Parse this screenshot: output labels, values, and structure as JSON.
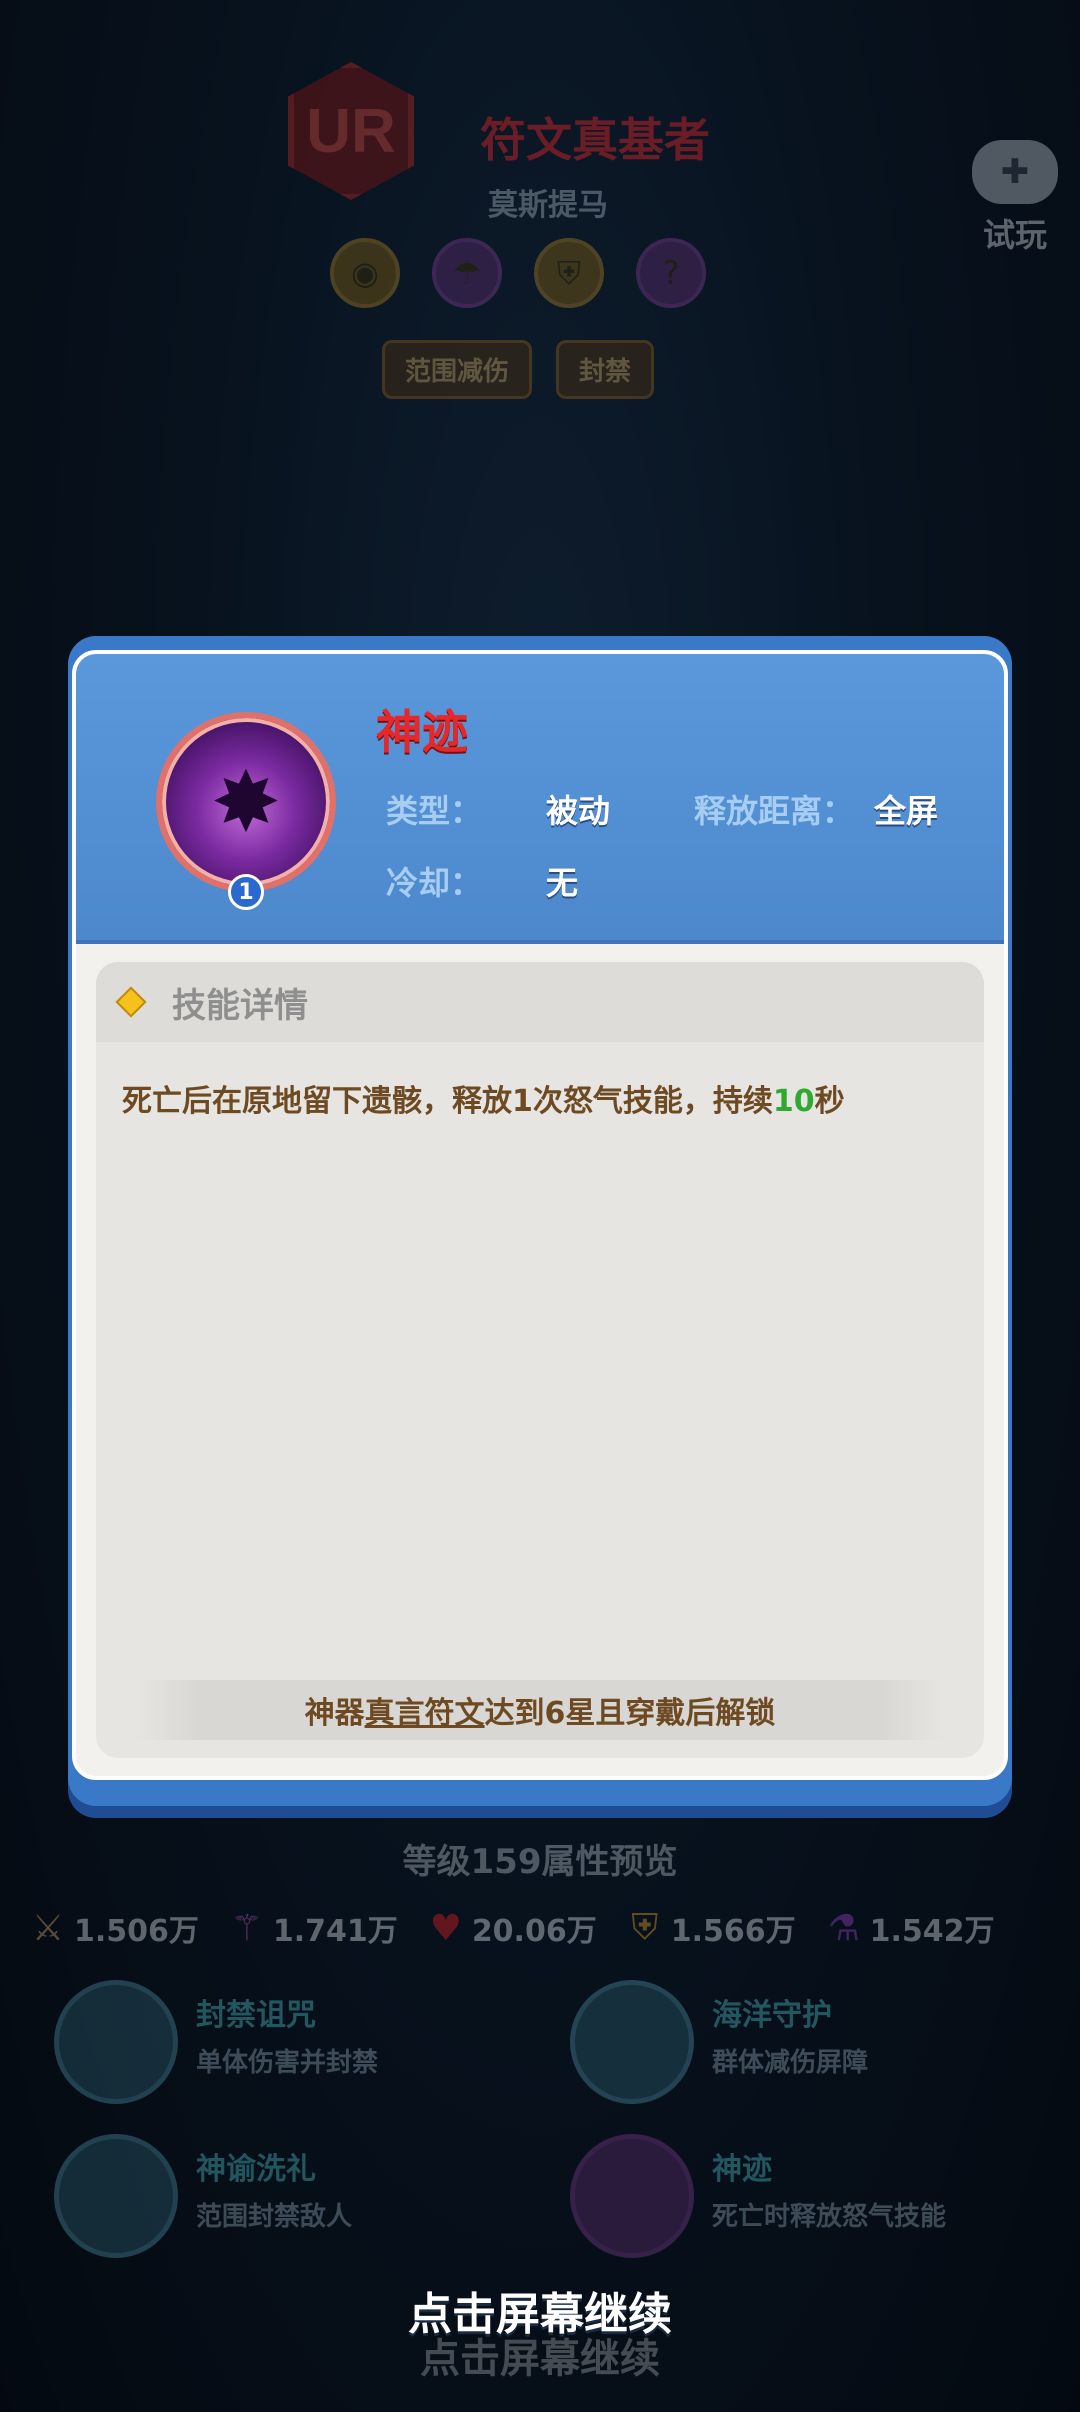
{
  "hero": {
    "rank": "UR",
    "name": "符文真基者",
    "subtitle": "莫斯提马",
    "tags": [
      "范围减伤",
      "封禁"
    ]
  },
  "trial": {
    "label": "试玩",
    "icon": "gamepad-icon"
  },
  "popup": {
    "skill_name": "神迹",
    "skill_level": "1",
    "type_label": "类型：",
    "type_value": "被动",
    "range_label": "释放距离：",
    "range_value": "全屏",
    "cooldown_label": "冷却：",
    "cooldown_value": "无",
    "section_title": "技能详情",
    "description_pre": "死亡后在原地留下遗骸，释放1次怒气技能，持续",
    "description_highlight": "10",
    "description_post": "秒",
    "unlock_pre": "神器",
    "unlock_underline": "真言符文",
    "unlock_post": "达到6星且穿戴后解锁"
  },
  "preview": {
    "title": "等级159属性预览",
    "stats": [
      {
        "icon": "sword-icon",
        "value": "1.506万"
      },
      {
        "icon": "wand-icon",
        "value": "1.741万"
      },
      {
        "icon": "heart-icon",
        "value": "20.06万"
      },
      {
        "icon": "shield-icon",
        "value": "1.566万"
      },
      {
        "icon": "potion-icon",
        "value": "1.542万"
      }
    ],
    "skills": [
      {
        "name": "封禁诅咒",
        "desc": "单体伤害并封禁"
      },
      {
        "name": "海洋守护",
        "desc": "群体减伤屏障"
      },
      {
        "name": "神谕洗礼",
        "desc": "范围封禁敌人"
      },
      {
        "name": "神迹",
        "desc": "死亡时释放怒气技能"
      }
    ]
  },
  "continue_text": "点击屏幕继续"
}
